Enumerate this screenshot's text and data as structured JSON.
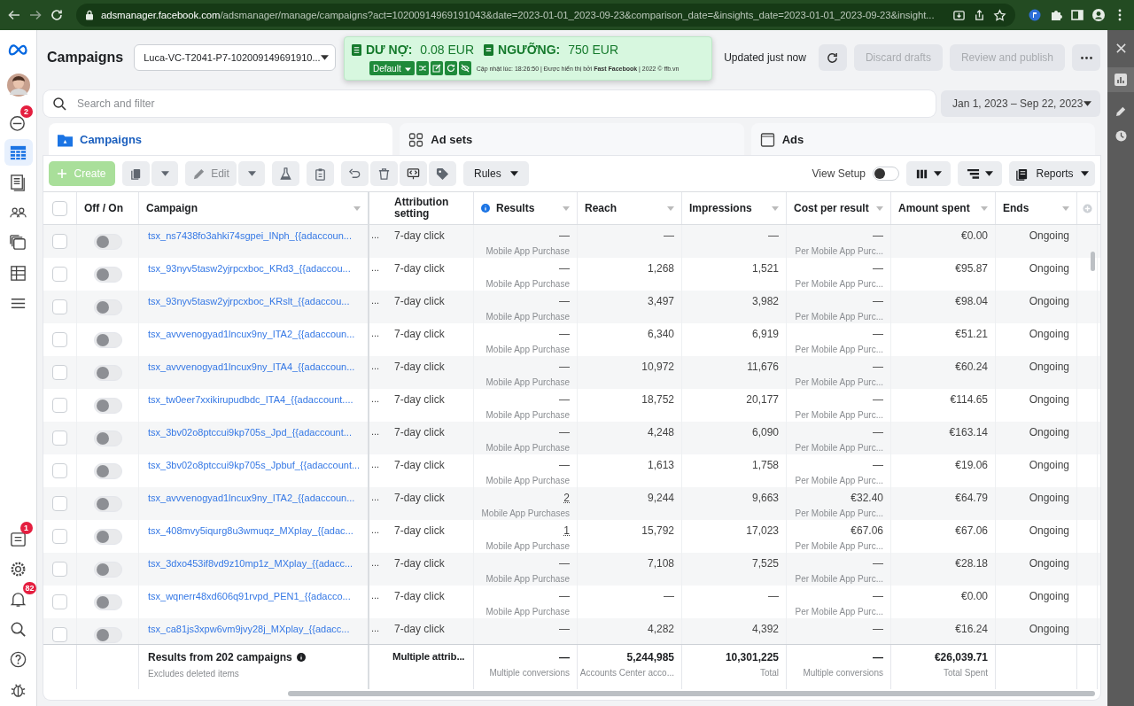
{
  "browser": {
    "host": "adsmanager.facebook.com",
    "path": "/adsmanager/manage/campaigns?act=10200914969191043&date=2023-01-01_2023-09-23&comparison_date=&insights_date=2023-01-01_2023-09-23&insight..."
  },
  "nav": {
    "badges": [
      {
        "kind": "inbox",
        "count": "2"
      },
      {
        "kind": "list",
        "count": "1"
      },
      {
        "kind": "bell",
        "count": "82"
      }
    ]
  },
  "header": {
    "title": "Campaigns",
    "account": "Luca-VC-T2041-P7-102009149691910...",
    "updated": "Updated just now",
    "buttons": [
      {
        "label": "Discard drafts",
        "disabled": true
      },
      {
        "label": "Review and publish",
        "disabled": true
      }
    ]
  },
  "extension": {
    "debt_label": "DƯ NỢ:",
    "debt": "0.08 EUR",
    "threshold_label": "NGƯỠNG:",
    "threshold": "750 EUR",
    "preset": "Default",
    "footer": "Cập nhật lúc: 18:26:50 | Được hiển thị bởi **Fast Facebook** | 2022 © ffb.vn"
  },
  "search": {
    "placeholder": "Search and filter"
  },
  "date_range": "Jan 1, 2023 – Sep 22, 2023",
  "tabs": [
    {
      "label": "Campaigns",
      "selected": true
    },
    {
      "label": "Ad sets",
      "selected": false
    },
    {
      "label": "Ads",
      "selected": false
    }
  ],
  "toolbar": {
    "create": {
      "label": "Create",
      "disabled": true
    },
    "edit": {
      "label": "Edit",
      "disabled": true
    },
    "rules": "Rules",
    "view_setup": {
      "label": "View Setup",
      "on": false
    },
    "reports": "Reports"
  },
  "table": {
    "select_all": {
      "checked": false
    },
    "columns": [
      "Off / On",
      "Campaign",
      "Attribution setting",
      "Results",
      "Reach",
      "Impressions",
      "Cost per result",
      "Amount spent",
      "Ends"
    ],
    "rows": [
      {
        "checked": false,
        "on": false,
        "campaign": "tsx_ns7438fo3ahki74sgpei_INph_{{adaccoun...",
        "column_4": "...",
        "attribution": "7-day click",
        "results": "—",
        "results_sub": "Mobile App Purchase",
        "reach": "—",
        "impressions": "—",
        "cost": "—",
        "cost_sub": "Per Mobile App Purc...",
        "spent": "€0.00",
        "ends": "Ongoing"
      },
      {
        "checked": false,
        "on": false,
        "campaign": "tsx_93nyv5tasw2yjrpcxboc_KRd3_{{adaccou...",
        "column_4": "...",
        "attribution": "7-day click",
        "results": "—",
        "results_sub": "Mobile App Purchase",
        "reach": "1,268",
        "impressions": "1,521",
        "cost": "—",
        "cost_sub": "Per Mobile App Purc...",
        "spent": "€95.87",
        "ends": "Ongoing"
      },
      {
        "checked": false,
        "on": false,
        "campaign": "tsx_93nyv5tasw2yjrpcxboc_KRslt_{{adaccou...",
        "column_4": "...",
        "attribution": "7-day click",
        "results": "—",
        "results_sub": "Mobile App Purchase",
        "reach": "3,497",
        "impressions": "3,982",
        "cost": "—",
        "cost_sub": "Per Mobile App Purc...",
        "spent": "€98.04",
        "ends": "Ongoing"
      },
      {
        "checked": false,
        "on": false,
        "campaign": "tsx_avvvenogyad1lncux9ny_ITA2_{{adaccoun...",
        "column_4": "...",
        "attribution": "7-day click",
        "results": "—",
        "results_sub": "Mobile App Purchase",
        "reach": "6,340",
        "impressions": "6,919",
        "cost": "—",
        "cost_sub": "Per Mobile App Purc...",
        "spent": "€51.21",
        "ends": "Ongoing"
      },
      {
        "checked": false,
        "on": false,
        "campaign": "tsx_avvvenogyad1lncux9ny_ITA4_{{adaccoun...",
        "column_4": "...",
        "attribution": "7-day click",
        "results": "—",
        "results_sub": "Mobile App Purchase",
        "reach": "10,972",
        "impressions": "11,676",
        "cost": "—",
        "cost_sub": "Per Mobile App Purc...",
        "spent": "€60.24",
        "ends": "Ongoing"
      },
      {
        "checked": false,
        "on": false,
        "campaign": "tsx_tw0eer7xxikirupudbdc_ITA4_{{adaccount....",
        "column_4": "...",
        "attribution": "7-day click",
        "results": "—",
        "results_sub": "Mobile App Purchase",
        "reach": "18,752",
        "impressions": "20,177",
        "cost": "—",
        "cost_sub": "Per Mobile App Purc...",
        "spent": "€114.65",
        "ends": "Ongoing"
      },
      {
        "checked": false,
        "on": false,
        "campaign": "tsx_3bv02o8ptccui9kp705s_Jpd_{{adaccount...",
        "column_4": "...",
        "attribution": "7-day click",
        "results": "—",
        "results_sub": "Mobile App Purchase",
        "reach": "4,248",
        "impressions": "6,090",
        "cost": "—",
        "cost_sub": "Per Mobile App Purc...",
        "spent": "€163.14",
        "ends": "Ongoing"
      },
      {
        "checked": false,
        "on": false,
        "campaign": "tsx_3bv02o8ptccui9kp705s_Jpbuf_{{adaccount...",
        "column_4": "...",
        "attribution": "7-day click",
        "results": "—",
        "results_sub": "Mobile App Purchase",
        "reach": "1,613",
        "impressions": "1,758",
        "cost": "—",
        "cost_sub": "Per Mobile App Purc...",
        "spent": "€19.06",
        "ends": "Ongoing"
      },
      {
        "checked": false,
        "on": false,
        "campaign": "tsx_avvvenogyad1lncux9ny_ITA2_{{adaccoun...",
        "column_4": "...",
        "attribution": "7-day click",
        "results": "2",
        "results_sub": "Mobile App Purchases",
        "reach": "9,244",
        "impressions": "9,663",
        "cost": "€32.40",
        "cost_sub": "Per Mobile App Purc...",
        "spent": "€64.79",
        "ends": "Ongoing"
      },
      {
        "checked": false,
        "on": false,
        "campaign": "tsx_408mvy5iqurg8u3wmuqz_MXplay_{{adac...",
        "column_4": "...",
        "attribution": "7-day click",
        "results": "1",
        "results_sub": "Mobile App Purchase",
        "reach": "15,792",
        "impressions": "17,023",
        "cost": "€67.06",
        "cost_sub": "Per Mobile App Purc...",
        "spent": "€67.06",
        "ends": "Ongoing"
      },
      {
        "checked": false,
        "on": false,
        "campaign": "tsx_3dxo453if8vd9z10mp1z_MXplay_{{adacc...",
        "column_4": "...",
        "attribution": "7-day click",
        "results": "—",
        "results_sub": "Mobile App Purchase",
        "reach": "7,108",
        "impressions": "7,525",
        "cost": "—",
        "cost_sub": "Per Mobile App Purc...",
        "spent": "€28.18",
        "ends": "Ongoing"
      },
      {
        "checked": false,
        "on": false,
        "campaign": "tsx_wqnerr48xd606q91rvpd_PEN1_{{adacco...",
        "column_4": "...",
        "attribution": "7-day click",
        "results": "—",
        "results_sub": "Mobile App Purchase",
        "reach": "—",
        "impressions": "—",
        "cost": "—",
        "cost_sub": "Per Mobile App Purc...",
        "spent": "€0.00",
        "ends": "Ongoing"
      },
      {
        "checked": false,
        "on": false,
        "campaign": "tsx_ca81js3xpw6vm9jvy28j_MXplay_{{adacc...",
        "column_4": "...",
        "attribution": "7-day click",
        "results": "—",
        "reach": "4,282",
        "impressions": "4,392",
        "cost": "—",
        "spent": "€16.24",
        "ends": "Ongoing"
      }
    ],
    "footer": {
      "title": "Results from 202 campaigns",
      "note": "Excludes deleted items",
      "attribution": "Multiple attrib...",
      "results": "—",
      "results_sub": "Multiple conversions",
      "reach": "5,244,985",
      "reach_sub": "Accounts Center acco...",
      "impressions": "10,301,225",
      "impressions_sub": "Total",
      "cost": "—",
      "cost_sub": "Multiple conversions",
      "spent": "€26,039.71",
      "spent_sub": "Total Spent"
    }
  }
}
